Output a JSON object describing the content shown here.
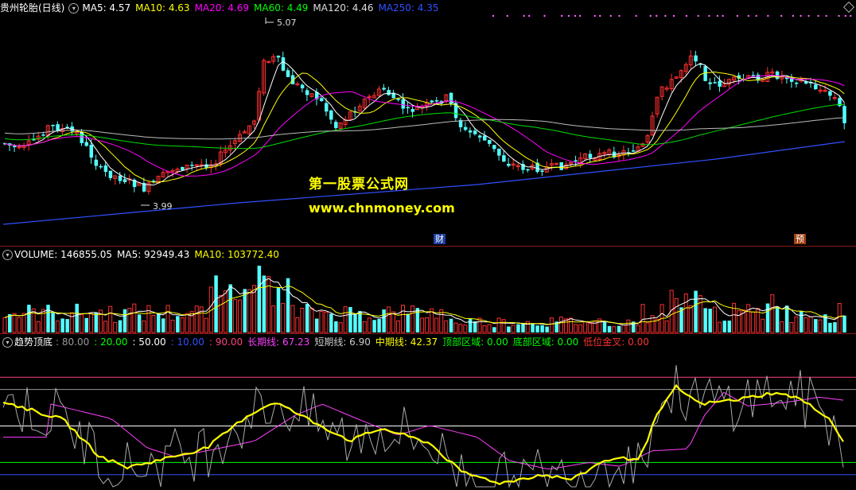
{
  "price_panel": {
    "title": "贵州轮胎(日线)",
    "ma": [
      {
        "label": "MA5: 4.57",
        "color": "#ffffff"
      },
      {
        "label": "MA10: 4.63",
        "color": "#ffff00"
      },
      {
        "label": "MA20: 4.69",
        "color": "#ff00ff"
      },
      {
        "label": "MA60: 4.49",
        "color": "#00ff00"
      },
      {
        "label": "MA120: 4.46",
        "color": "#dddddd"
      },
      {
        "label": "MA250: 4.35",
        "color": "#3050ff"
      }
    ],
    "high_label": "5.07",
    "low_label": "3.99",
    "tag_cai": "财",
    "tag_yu": "预"
  },
  "volume_panel": {
    "title": "VOLUME: 146855.05",
    "ma5": "MA5: 92949.43",
    "ma10": "MA10: 103772.40"
  },
  "indicator_panel": {
    "title": "趋势顶底",
    "items": [
      {
        "label": ": 80.00",
        "color": "#999999"
      },
      {
        "label": ": 20.00",
        "color": "#00ff00"
      },
      {
        "label": ": 50.00",
        "color": "#ffffff"
      },
      {
        "label": ": 10.00",
        "color": "#3050ff"
      },
      {
        "label": ": 90.00",
        "color": "#ff4080"
      },
      {
        "label": "长期线: 67.23",
        "color": "#ff40ff"
      },
      {
        "label": "短期线: 6.90",
        "color": "#cccccc"
      },
      {
        "label": "中期线: 42.37",
        "color": "#ffff00"
      },
      {
        "label": "顶部区域: 0.00",
        "color": "#00ff00"
      },
      {
        "label": "底部区域: 0.00",
        "color": "#00ff00"
      },
      {
        "label": "低位金叉: 0.00",
        "color": "#ff3030"
      }
    ]
  },
  "watermark": {
    "line1": "第一股票公式网",
    "line2": "www.chnmoney.com"
  },
  "colors": {
    "up": "#ff3030",
    "down": "#54ffff",
    "divider": "#8b1a1a"
  }
}
